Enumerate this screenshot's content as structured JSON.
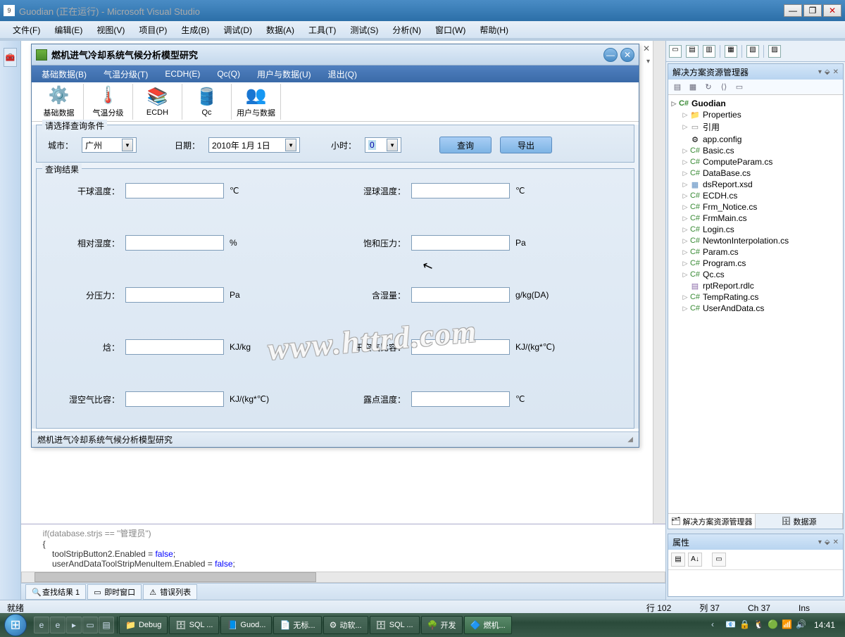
{
  "vs": {
    "icon_text": "9",
    "title": "Guodian (正在运行) - Microsoft Visual Studio",
    "menus": [
      "文件(F)",
      "编辑(E)",
      "视图(V)",
      "项目(P)",
      "生成(B)",
      "调试(D)",
      "数据(A)",
      "工具(T)",
      "测试(S)",
      "分析(N)",
      "窗口(W)",
      "帮助(H)"
    ],
    "status": {
      "ready": "就绪",
      "line": "行 102",
      "col": "列 37",
      "ch": "Ch 37",
      "ins": "Ins"
    }
  },
  "child": {
    "title": "燃机进气冷却系统气候分析模型研究",
    "menus": [
      "基础数据(B)",
      "气温分级(T)",
      "ECDH(E)",
      "Qc(Q)",
      "用户与数据(U)",
      "退出(Q)"
    ],
    "toolbar": [
      {
        "label": "基础数据"
      },
      {
        "label": "气温分级"
      },
      {
        "label": "ECDH"
      },
      {
        "label": "Qc"
      },
      {
        "label": "用户与数据"
      }
    ],
    "query_group_title": "请选择查询条件",
    "city_label": "城市：",
    "city_value": "广州",
    "date_label": "日期：",
    "date_value": "2010年 1月 1日",
    "hour_label": "小时：",
    "hour_value": "0",
    "btn_query": "查询",
    "btn_export": "导出",
    "result_group_title": "查询结果",
    "fields_left": [
      {
        "label": "干球温度：",
        "unit": "℃"
      },
      {
        "label": "相对湿度：",
        "unit": "%"
      },
      {
        "label": "分压力：",
        "unit": "Pa"
      },
      {
        "label": "焓：",
        "unit": "KJ/kg"
      },
      {
        "label": "湿空气比容：",
        "unit": "KJ/(kg*℃)"
      }
    ],
    "fields_right": [
      {
        "label": "湿球温度：",
        "unit": "℃"
      },
      {
        "label": "饱和压力：",
        "unit": "Pa"
      },
      {
        "label": "含湿量：",
        "unit": "g/kg(DA)"
      },
      {
        "label": "干空气比容：",
        "unit": "KJ/(kg*℃)"
      },
      {
        "label": "露点温度：",
        "unit": "℃"
      }
    ],
    "status_text": "燃机进气冷却系统气候分析模型研究"
  },
  "code": {
    "line0": "        if(database.strjs == \"管理员\")",
    "line1": "        {",
    "line2_a": "            toolStripButton2.Enabled = ",
    "line2_b": "false",
    "line2_c": ";",
    "line3_a": "            userAndDataToolStripMenuItem.Enabled = ",
    "line3_b": "false",
    "line3_c": ";"
  },
  "bottom_tabs": [
    "查找结果 1",
    "即时窗口",
    "错误列表"
  ],
  "explorer": {
    "title": "解决方案资源管理器",
    "project": "Guodian",
    "items": [
      {
        "icon": "folder",
        "label": "Properties",
        "exp": "▷"
      },
      {
        "icon": "ref",
        "label": "引用",
        "exp": "▷"
      },
      {
        "icon": "cfg",
        "label": "app.config",
        "exp": ""
      },
      {
        "icon": "csharp",
        "label": "Basic.cs",
        "exp": "▷"
      },
      {
        "icon": "csharp",
        "label": "ComputeParam.cs",
        "exp": "▷"
      },
      {
        "icon": "csharp",
        "label": "DataBase.cs",
        "exp": "▷"
      },
      {
        "icon": "xsd",
        "label": "dsReport.xsd",
        "exp": "▷"
      },
      {
        "icon": "csharp",
        "label": "ECDH.cs",
        "exp": "▷"
      },
      {
        "icon": "csharp",
        "label": "Frm_Notice.cs",
        "exp": "▷"
      },
      {
        "icon": "csharp",
        "label": "FrmMain.cs",
        "exp": "▷"
      },
      {
        "icon": "csharp",
        "label": "Login.cs",
        "exp": "▷"
      },
      {
        "icon": "csharp",
        "label": "NewtonInterpolation.cs",
        "exp": "▷"
      },
      {
        "icon": "csharp",
        "label": "Param.cs",
        "exp": "▷"
      },
      {
        "icon": "csharp",
        "label": "Program.cs",
        "exp": "▷"
      },
      {
        "icon": "csharp",
        "label": "Qc.cs",
        "exp": "▷"
      },
      {
        "icon": "rdlc",
        "label": "rptReport.rdlc",
        "exp": ""
      },
      {
        "icon": "csharp",
        "label": "TempRating.cs",
        "exp": "▷"
      },
      {
        "icon": "csharp",
        "label": "UserAndData.cs",
        "exp": "▷"
      }
    ],
    "bottom_tab1": "解决方案资源管理器",
    "bottom_tab2": "数据源"
  },
  "properties": {
    "title": "属性"
  },
  "watermark": "www.httrd.com",
  "taskbar": {
    "tasks": [
      {
        "icon": "📁",
        "label": "Debug"
      },
      {
        "icon": "🗄",
        "label": "SQL ..."
      },
      {
        "icon": "📘",
        "label": "Guod..."
      },
      {
        "icon": "📄",
        "label": "无标..."
      },
      {
        "icon": "⚙",
        "label": "动软..."
      },
      {
        "icon": "🗄",
        "label": "SQL ..."
      },
      {
        "icon": "🌳",
        "label": "开发"
      },
      {
        "icon": "🔷",
        "label": "燃机..."
      }
    ],
    "clock": "14:41"
  }
}
